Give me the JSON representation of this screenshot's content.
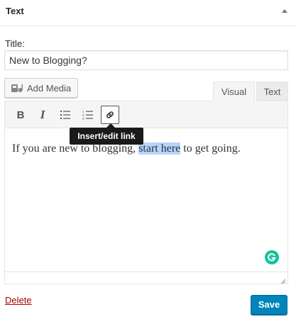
{
  "widget": {
    "title": "Text",
    "collapse_icon": "triangle-up-icon"
  },
  "form": {
    "title_label": "Title:",
    "title_value": "New to Blogging?"
  },
  "media": {
    "add_media_label": "Add Media",
    "icon": "media-icon"
  },
  "tabs": [
    {
      "label": "Visual",
      "active": true
    },
    {
      "label": "Text",
      "active": false
    }
  ],
  "toolbar": {
    "bold_label": "B",
    "italic_label": "I",
    "icons": [
      "bold-icon",
      "italic-icon",
      "bullet-list-icon",
      "numbered-list-icon",
      "link-icon"
    ],
    "tooltip": "Insert/edit link"
  },
  "content": {
    "before": "If you are new to blogging, ",
    "selected": "start here",
    "after": " to get going."
  },
  "actions": {
    "delete_label": "Delete",
    "save_label": "Save"
  },
  "colors": {
    "primary_button": "#0085ba",
    "delete_link": "#a00000",
    "selection": "#b4d5fe",
    "grammarly": "#15c39a"
  }
}
